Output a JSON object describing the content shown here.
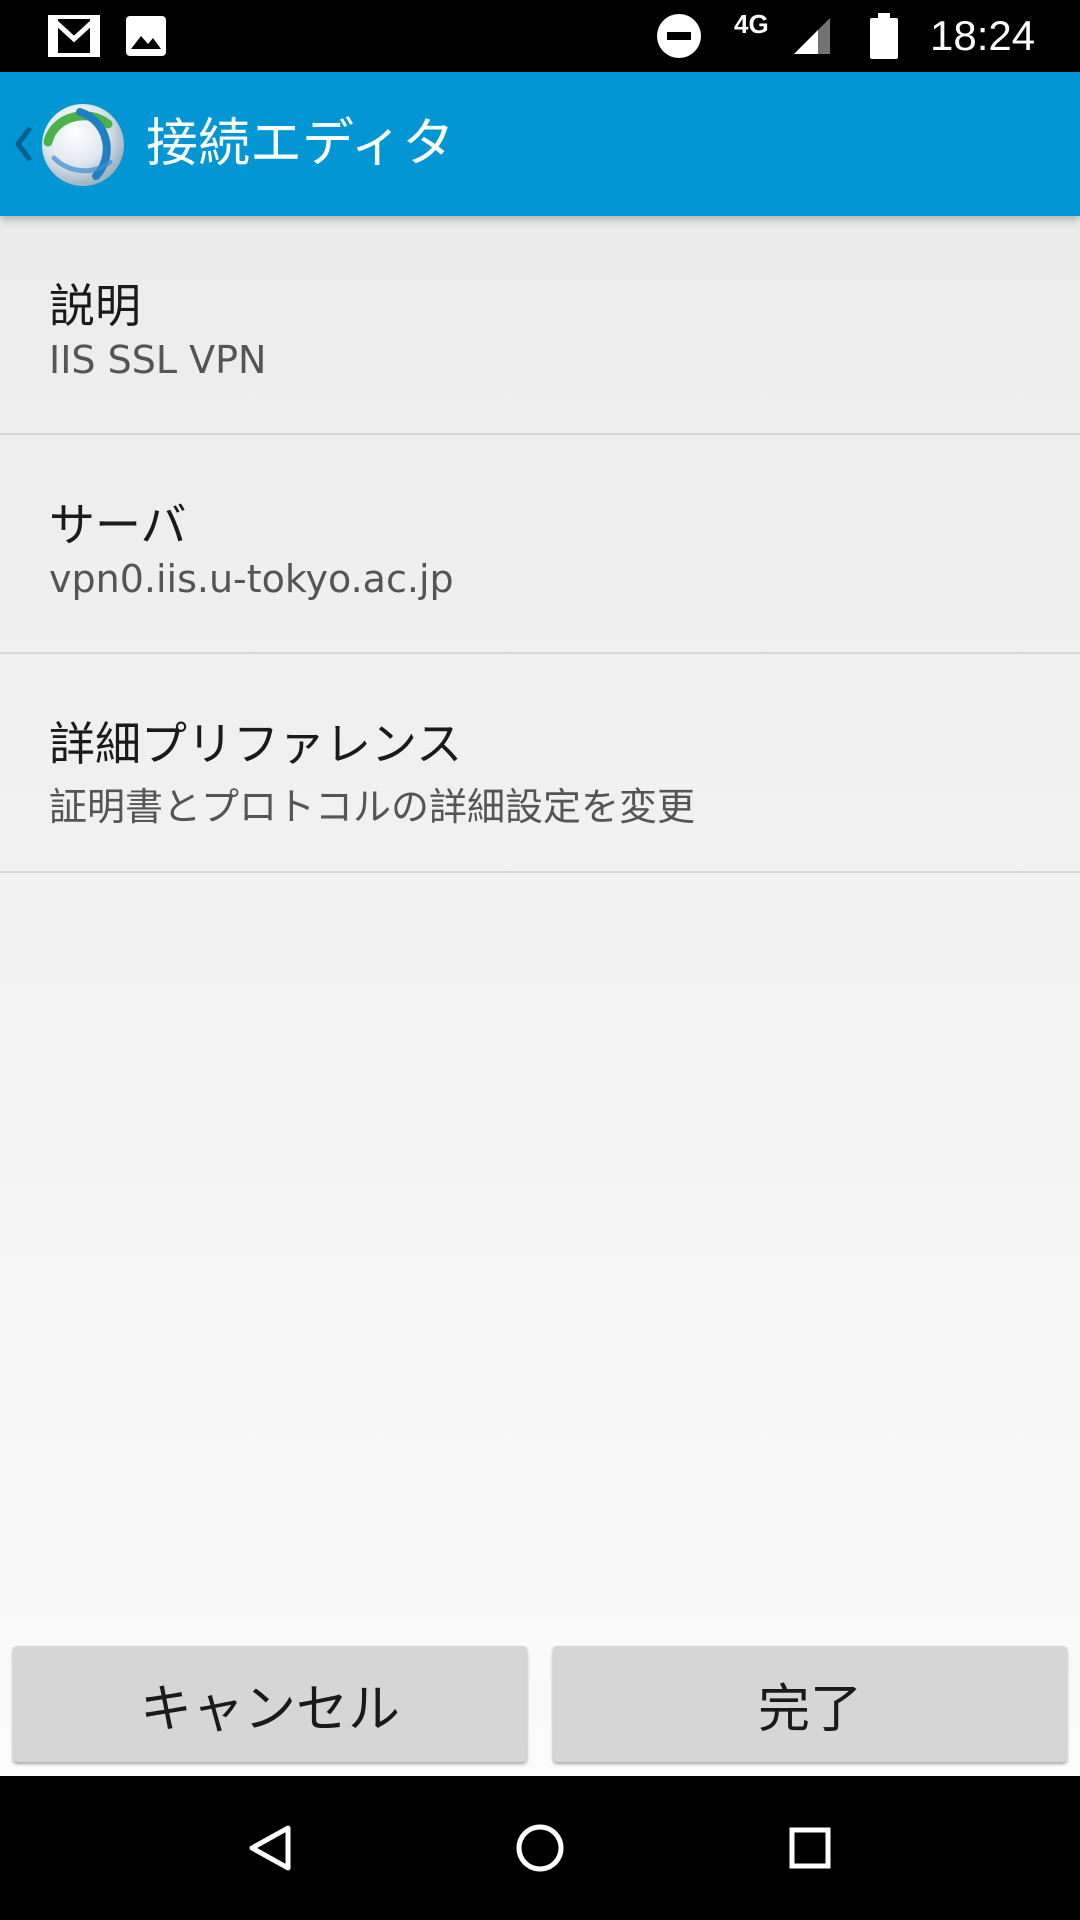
{
  "status_bar": {
    "time": "18:24",
    "network": "4G",
    "icons": [
      "gmail-icon",
      "image-icon",
      "do-not-disturb-icon",
      "signal-icon",
      "battery-icon"
    ]
  },
  "app_bar": {
    "title": "接続エディタ",
    "color": "#0296d4",
    "icons": [
      "back-chevron-icon",
      "anyconnect-logo-icon"
    ]
  },
  "preferences": [
    {
      "title": "説明",
      "summary": "IIS SSL VPN"
    },
    {
      "title": "サーバ",
      "summary": "vpn0.iis.u-tokyo.ac.jp"
    },
    {
      "title": "詳細プリファレンス",
      "summary": "証明書とプロトコルの詳細設定を変更"
    }
  ],
  "buttons": {
    "cancel_label": "キャンセル",
    "done_label": "完了"
  },
  "nav_bar": {
    "icons": [
      "back-triangle-icon",
      "home-circle-icon",
      "recents-square-icon"
    ]
  }
}
